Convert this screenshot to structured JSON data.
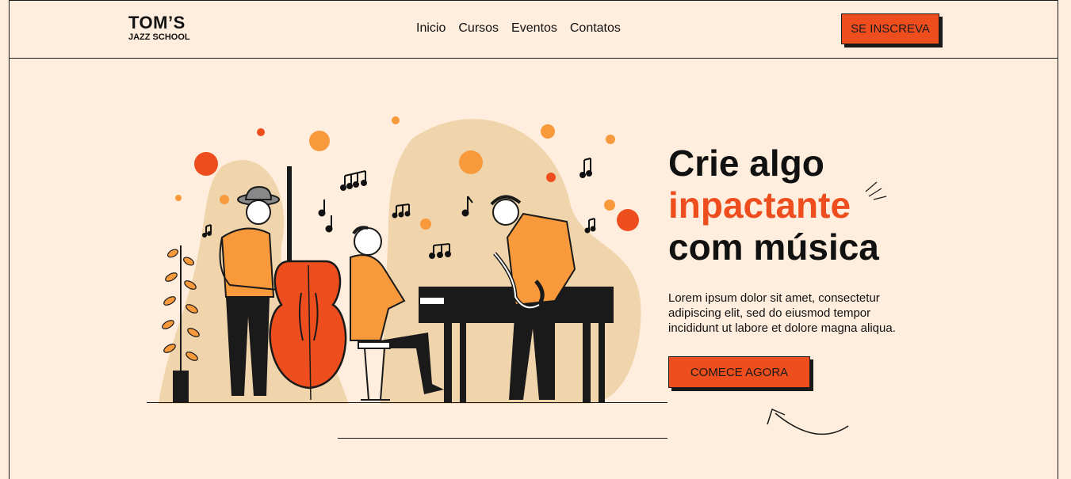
{
  "brand": {
    "name": "TOM’S",
    "subtitle": "JAZZ SCHOOL"
  },
  "nav": {
    "items": [
      "Inicio",
      "Cursos",
      "Eventos",
      "Contatos"
    ]
  },
  "header": {
    "signup_label": "SE INSCREVA"
  },
  "hero": {
    "title_line1": "Crie algo",
    "title_line2": "inpactante",
    "title_line3": "com música",
    "description": "Lorem ipsum dolor sit amet, consectetur adipiscing elit, sed do eiusmod tempor incididunt ut labore et dolore magna aliqua.",
    "cta_label": "COMECE AGORA"
  },
  "colors": {
    "background": "#ffeddd",
    "accent": "#ee4e1e",
    "orange": "#f7941d",
    "blob": "#f0d5ac",
    "dark": "#111111"
  },
  "icons": {
    "illustration": "jazz-band-illustration",
    "arrow": "curved-arrow-icon",
    "sparkle": "sparkle-icon"
  }
}
